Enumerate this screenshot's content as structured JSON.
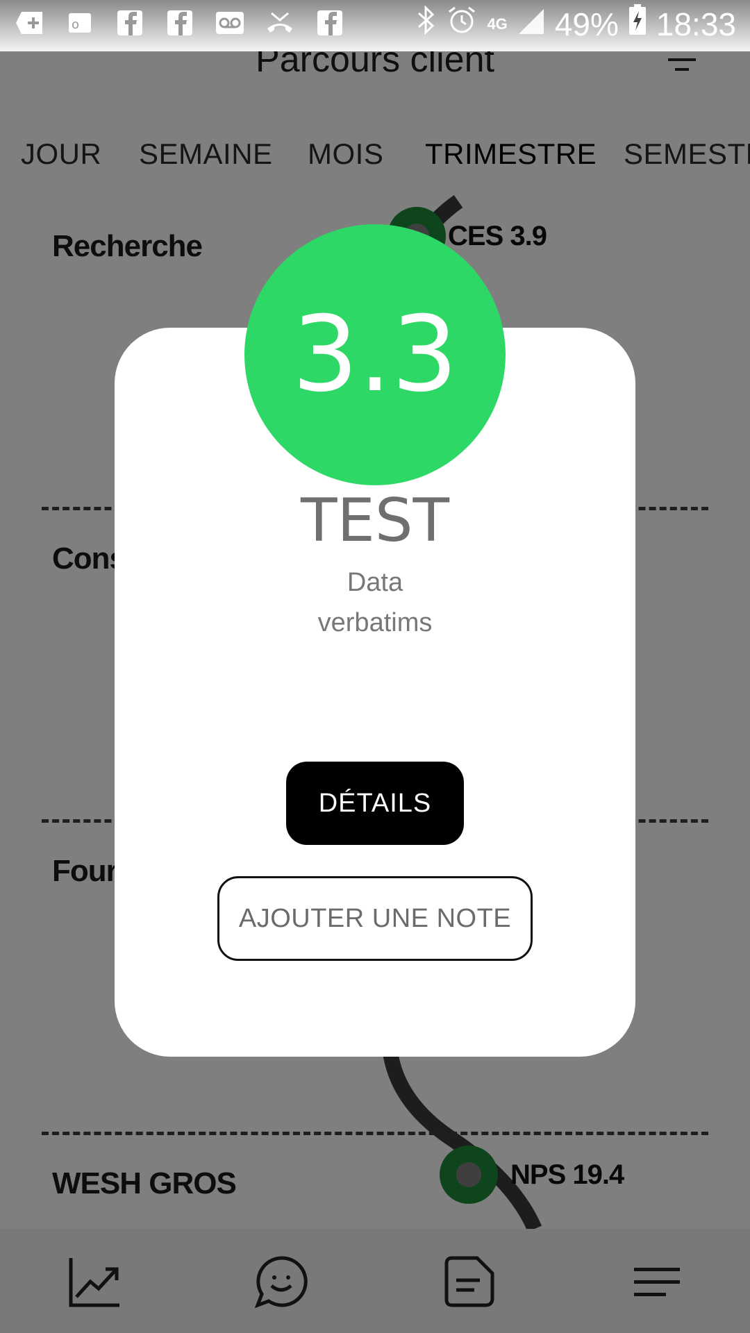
{
  "status_bar": {
    "battery_percent": "49%",
    "network": "4G",
    "time": "18:33"
  },
  "header": {
    "title": "Parcours client"
  },
  "tabs": [
    {
      "label": "JOUR"
    },
    {
      "label": "SEMAINE"
    },
    {
      "label": "MOIS"
    },
    {
      "label": "TRIMESTRE",
      "active": true
    },
    {
      "label": "SEMESTR"
    }
  ],
  "steps": [
    {
      "label": "Recherche",
      "metric": "CES 3.9"
    },
    {
      "label": "Cons"
    },
    {
      "label": "Four"
    },
    {
      "label": "WESH GROS",
      "metric": "NPS 19.4"
    }
  ],
  "modal": {
    "score": "3.3",
    "title": "TEST",
    "subtitle_line1": "Data",
    "subtitle_line2": "verbatims",
    "details_button": "DÉTAILS",
    "add_note_button": "AJOUTER UNE NOTE"
  },
  "colors": {
    "score_green": "#2ed866",
    "node_green": "#1f8a3a",
    "overlay": "rgba(0,0,0,0.5)"
  },
  "icons": {
    "bottom_nav": [
      "chart-trend-icon",
      "chat-smiley-icon",
      "note-icon",
      "menu-icon"
    ]
  }
}
